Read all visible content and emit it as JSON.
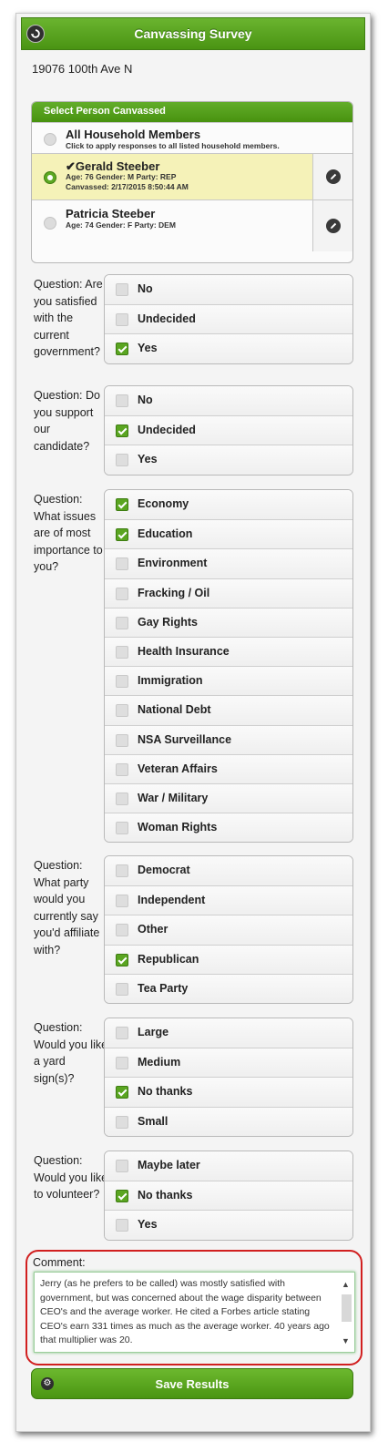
{
  "header": {
    "title": "Canvassing Survey",
    "back_icon": "back-icon"
  },
  "address": "19076 100th Ave N",
  "person_selector": {
    "title": "Select Person Canvassed",
    "all": {
      "name": "All Household Members",
      "sub": "Click to apply responses to all listed household members."
    },
    "people": [
      {
        "check": "✔",
        "name": "Gerald Steeber",
        "line1": "Age: 76 Gender: M Party: REP",
        "line2": "Canvassed: 2/17/2015 8:50:44 AM",
        "selected": true
      },
      {
        "name": "Patricia Steeber",
        "line1": "Age: 74 Gender: F Party: DEM",
        "selected": false
      }
    ]
  },
  "questions": [
    {
      "text": "Question: Are you satisfied with the current government?",
      "options": [
        {
          "label": "No",
          "checked": false
        },
        {
          "label": "Undecided",
          "checked": false
        },
        {
          "label": "Yes",
          "checked": true
        }
      ]
    },
    {
      "text": "Question: Do you support our candidate?",
      "options": [
        {
          "label": "No",
          "checked": false
        },
        {
          "label": "Undecided",
          "checked": true
        },
        {
          "label": "Yes",
          "checked": false
        }
      ]
    },
    {
      "text": "Question: What issues are of most importance to you?",
      "options": [
        {
          "label": "Economy",
          "checked": true
        },
        {
          "label": "Education",
          "checked": true
        },
        {
          "label": "Environment",
          "checked": false
        },
        {
          "label": "Fracking / Oil",
          "checked": false
        },
        {
          "label": "Gay Rights",
          "checked": false
        },
        {
          "label": "Health Insurance",
          "checked": false
        },
        {
          "label": "Immigration",
          "checked": false
        },
        {
          "label": "National Debt",
          "checked": false
        },
        {
          "label": "NSA Surveillance",
          "checked": false
        },
        {
          "label": "Veteran Affairs",
          "checked": false
        },
        {
          "label": "War / Military",
          "checked": false
        },
        {
          "label": "Woman Rights",
          "checked": false
        }
      ]
    },
    {
      "text": "Question: What party would you currently say you'd affiliate with?",
      "options": [
        {
          "label": "Democrat",
          "checked": false
        },
        {
          "label": "Independent",
          "checked": false
        },
        {
          "label": "Other",
          "checked": false
        },
        {
          "label": "Republican",
          "checked": true
        },
        {
          "label": "Tea Party",
          "checked": false
        }
      ]
    },
    {
      "text": "Question: Would you like a yard sign(s)?",
      "options": [
        {
          "label": "Large",
          "checked": false
        },
        {
          "label": "Medium",
          "checked": false
        },
        {
          "label": "No thanks",
          "checked": true
        },
        {
          "label": "Small",
          "checked": false
        }
      ]
    },
    {
      "text": "Question: Would you like to volunteer?",
      "options": [
        {
          "label": "Maybe later",
          "checked": false
        },
        {
          "label": "No thanks",
          "checked": true
        },
        {
          "label": "Yes",
          "checked": false
        }
      ]
    }
  ],
  "comment": {
    "label": "Comment:",
    "value": "Jerry (as he prefers to be called) was mostly satisfied with government, but was concerned about the wage disparity between CEO's and the average worker.  He cited a Forbes article stating CEO's earn 331 times as much as the average worker.  40 years ago that multiplier was 20."
  },
  "save_label": "Save Results",
  "colors": {
    "accent": "#5aa521",
    "highlight_row": "#f5f2b8",
    "comment_outline": "#d11f1f"
  }
}
